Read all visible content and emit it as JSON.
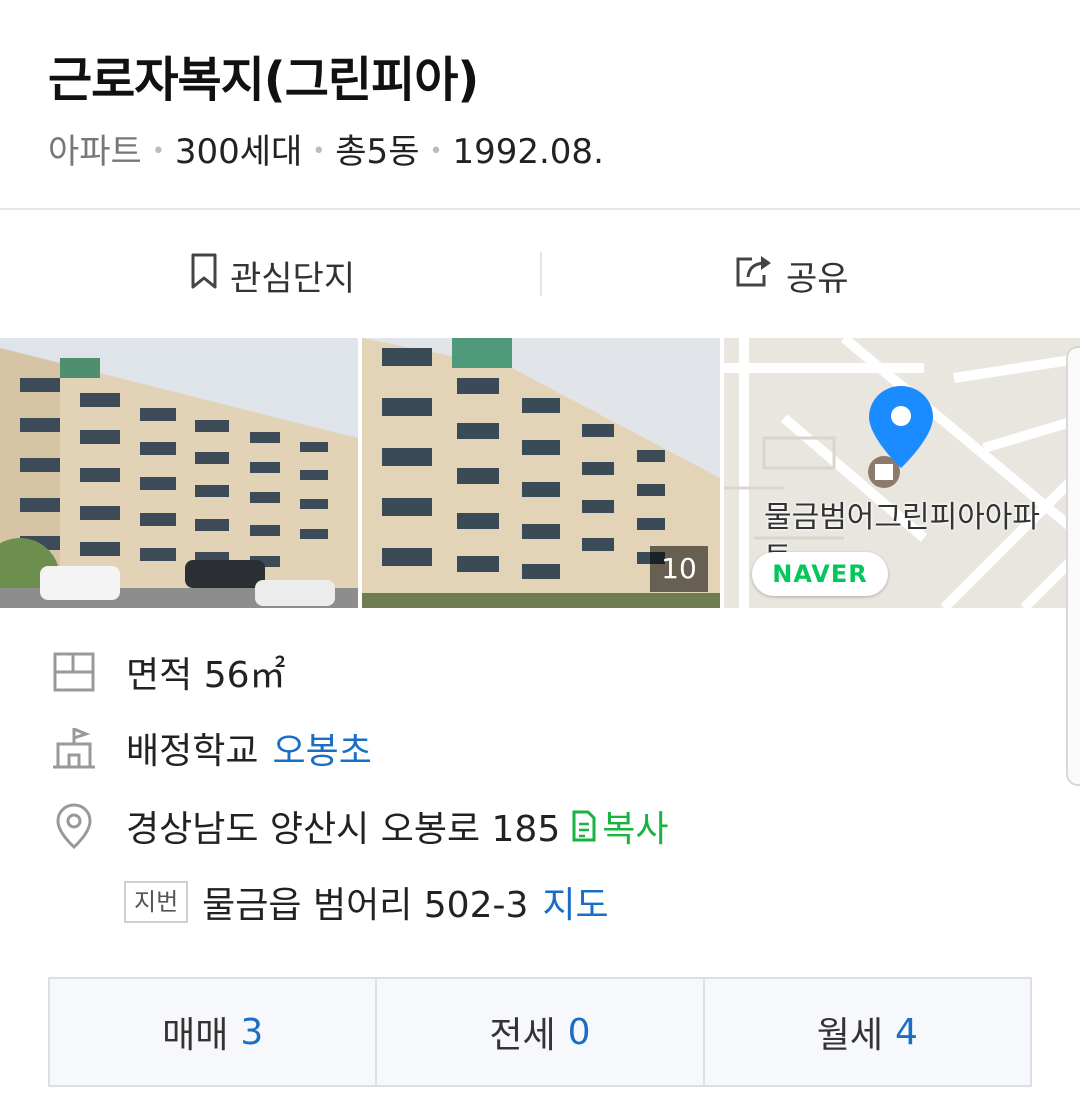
{
  "complex": {
    "title": "근로자복지(그린피아)",
    "type": "아파트",
    "households": "300세대",
    "buildings": "총5동",
    "completed": "1992.08."
  },
  "actions": {
    "favorite_label": "관심단지",
    "share_label": "공유"
  },
  "photos": {
    "count": "10",
    "map_label": "물금범어그린피아아파트",
    "map_provider": "NAVER"
  },
  "info": {
    "area_label": "면적",
    "area_value": "56㎡",
    "school_label": "배정학교",
    "school_value": "오봉초",
    "address": "경상남도 양산시 오봉로 185",
    "copy_label": "복사",
    "jibun_tag": "지번",
    "jibun_address": "물금읍 범어리 502-3",
    "map_link": "지도"
  },
  "deals": [
    {
      "label": "매매",
      "count": "3"
    },
    {
      "label": "전세",
      "count": "0"
    },
    {
      "label": "월세",
      "count": "4"
    }
  ],
  "colors": {
    "link_blue": "#1a6fc4",
    "copy_green": "#19b340",
    "naver_green": "#03c75a",
    "pin_blue": "#1a8cff"
  }
}
